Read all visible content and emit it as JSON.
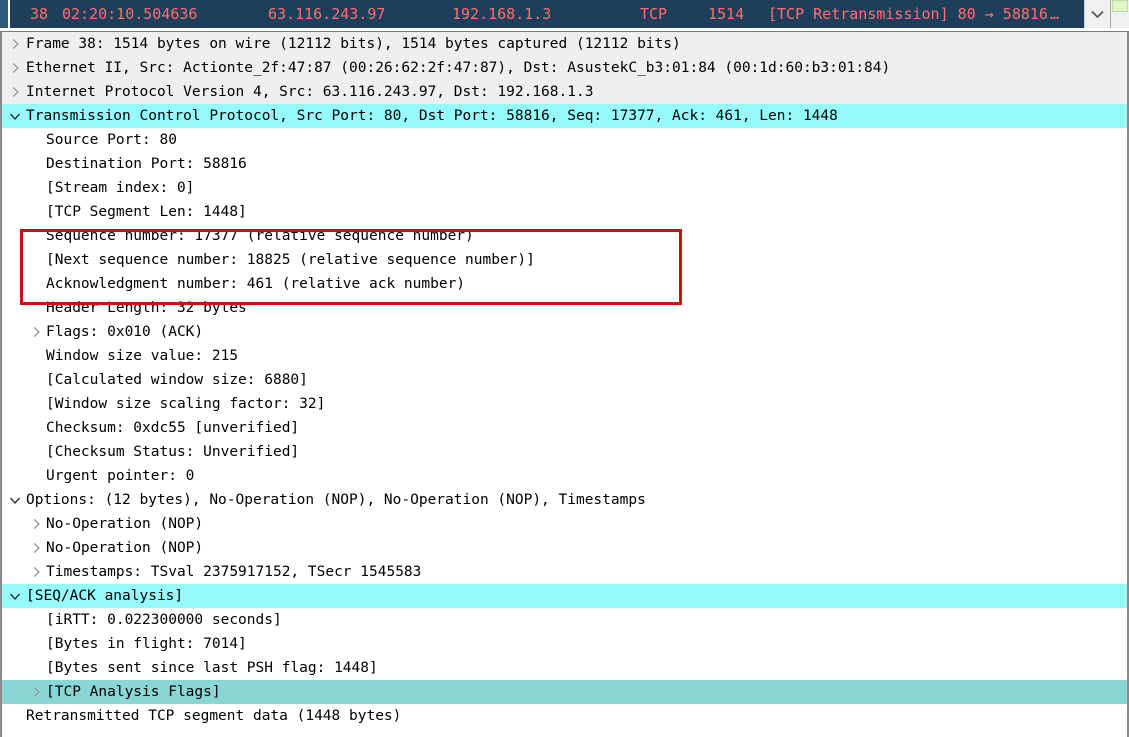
{
  "packet_list": {
    "row": {
      "no": "38",
      "time": "02:20:10.504636",
      "source": "63.116.243.97",
      "destination": "192.168.1.3",
      "protocol": "TCP",
      "length": "1514",
      "info": "[TCP Retransmission] 80 → 58816",
      "ellipsis": "…"
    },
    "selected_row_bg": "#1d3f5c",
    "selected_row_fg": "#ff6e6e",
    "scrollbar": {
      "down_arrow_icon": "chevron-down-icon",
      "thumb_color": "#dff5c8"
    }
  },
  "detail_tree": {
    "highlight_cyan": "#96fafa",
    "highlight_teal": "#88d6d6",
    "stripe_gray": "#efefef",
    "annotation": {
      "shape": "rectangle",
      "color": "#cc1111",
      "surrounds": [
        "[TCP Segment Len: 1448]",
        "Sequence number: 17377    (relative sequence number)",
        "[Next sequence number: 18825    (relative sequence number)]"
      ]
    },
    "rows": [
      {
        "text": "Frame 38: 1514 bytes on wire (12112 bits), 1514 bytes captured (12112 bits)",
        "depth": 1,
        "twisty": "collapsed",
        "bg": "gray",
        "name": "tree-row-frame"
      },
      {
        "text": "Ethernet II, Src: Actionte_2f:47:87 (00:26:62:2f:47:87), Dst: AsustekC_b3:01:84 (00:1d:60:b3:01:84)",
        "depth": 1,
        "twisty": "collapsed",
        "bg": "gray",
        "name": "tree-row-ethernet"
      },
      {
        "text": "Internet Protocol Version 4, Src: 63.116.243.97, Dst: 192.168.1.3",
        "depth": 1,
        "twisty": "collapsed",
        "bg": "gray",
        "name": "tree-row-ipv4"
      },
      {
        "text": "Transmission Control Protocol, Src Port: 80, Dst Port: 58816, Seq: 17377, Ack: 461, Len: 1448",
        "depth": 1,
        "twisty": "expanded",
        "bg": "cyan",
        "name": "tree-row-tcp"
      },
      {
        "text": "Source Port: 80",
        "depth": 2,
        "twisty": "none",
        "bg": "none",
        "name": "tree-row-source-port"
      },
      {
        "text": "Destination Port: 58816",
        "depth": 2,
        "twisty": "none",
        "bg": "none",
        "name": "tree-row-destination-port"
      },
      {
        "text": "[Stream index: 0]",
        "depth": 2,
        "twisty": "none",
        "bg": "none",
        "name": "tree-row-stream-index"
      },
      {
        "text": "[TCP Segment Len: 1448]",
        "depth": 2,
        "twisty": "none",
        "bg": "none",
        "name": "tree-row-tcp-segment-len"
      },
      {
        "text": "Sequence number: 17377    (relative sequence number)",
        "depth": 2,
        "twisty": "none",
        "bg": "none",
        "name": "tree-row-sequence-number"
      },
      {
        "text": "[Next sequence number: 18825    (relative sequence number)]",
        "depth": 2,
        "twisty": "none",
        "bg": "none",
        "name": "tree-row-next-sequence-number"
      },
      {
        "text": "Acknowledgment number: 461    (relative ack number)",
        "depth": 2,
        "twisty": "none",
        "bg": "none",
        "name": "tree-row-acknowledgment-number"
      },
      {
        "text": "Header Length: 32 bytes",
        "depth": 2,
        "twisty": "none",
        "bg": "none",
        "name": "tree-row-header-length"
      },
      {
        "text": "Flags: 0x010 (ACK)",
        "depth": 2,
        "twisty": "collapsed",
        "bg": "none",
        "name": "tree-row-flags"
      },
      {
        "text": "Window size value: 215",
        "depth": 2,
        "twisty": "none",
        "bg": "none",
        "name": "tree-row-window-size-value"
      },
      {
        "text": "[Calculated window size: 6880]",
        "depth": 2,
        "twisty": "none",
        "bg": "none",
        "name": "tree-row-calculated-window-size"
      },
      {
        "text": "[Window size scaling factor: 32]",
        "depth": 2,
        "twisty": "none",
        "bg": "none",
        "name": "tree-row-window-scaling-factor"
      },
      {
        "text": "Checksum: 0xdc55 [unverified]",
        "depth": 2,
        "twisty": "none",
        "bg": "none",
        "name": "tree-row-checksum"
      },
      {
        "text": "[Checksum Status: Unverified]",
        "depth": 2,
        "twisty": "none",
        "bg": "none",
        "name": "tree-row-checksum-status"
      },
      {
        "text": "Urgent pointer: 0",
        "depth": 2,
        "twisty": "none",
        "bg": "none",
        "name": "tree-row-urgent-pointer"
      },
      {
        "text": "Options: (12 bytes), No-Operation (NOP), No-Operation (NOP), Timestamps",
        "depth": 1,
        "twisty": "expanded",
        "bg": "none",
        "name": "tree-row-options"
      },
      {
        "text": "No-Operation (NOP)",
        "depth": 2,
        "twisty": "collapsed",
        "bg": "none",
        "name": "tree-row-nop-1"
      },
      {
        "text": "No-Operation (NOP)",
        "depth": 2,
        "twisty": "collapsed",
        "bg": "none",
        "name": "tree-row-nop-2"
      },
      {
        "text": "Timestamps: TSval 2375917152, TSecr 1545583",
        "depth": 2,
        "twisty": "collapsed",
        "bg": "none",
        "name": "tree-row-timestamps"
      },
      {
        "text": "[SEQ/ACK analysis]",
        "depth": 1,
        "twisty": "expanded",
        "bg": "cyan",
        "name": "tree-row-seq-ack-analysis"
      },
      {
        "text": "[iRTT: 0.022300000 seconds]",
        "depth": 2,
        "twisty": "none",
        "bg": "none",
        "name": "tree-row-irtt"
      },
      {
        "text": "[Bytes in flight: 7014]",
        "depth": 2,
        "twisty": "none",
        "bg": "none",
        "name": "tree-row-bytes-in-flight"
      },
      {
        "text": "[Bytes sent since last PSH flag: 1448]",
        "depth": 2,
        "twisty": "none",
        "bg": "none",
        "name": "tree-row-bytes-since-psh"
      },
      {
        "text": "[TCP Analysis Flags]",
        "depth": 2,
        "twisty": "collapsed",
        "bg": "teal",
        "name": "tree-row-tcp-analysis-flags"
      },
      {
        "text": "Retransmitted TCP segment data (1448 bytes)",
        "depth": 1,
        "twisty": "none",
        "bg": "none",
        "name": "tree-row-retransmitted-data"
      }
    ]
  }
}
